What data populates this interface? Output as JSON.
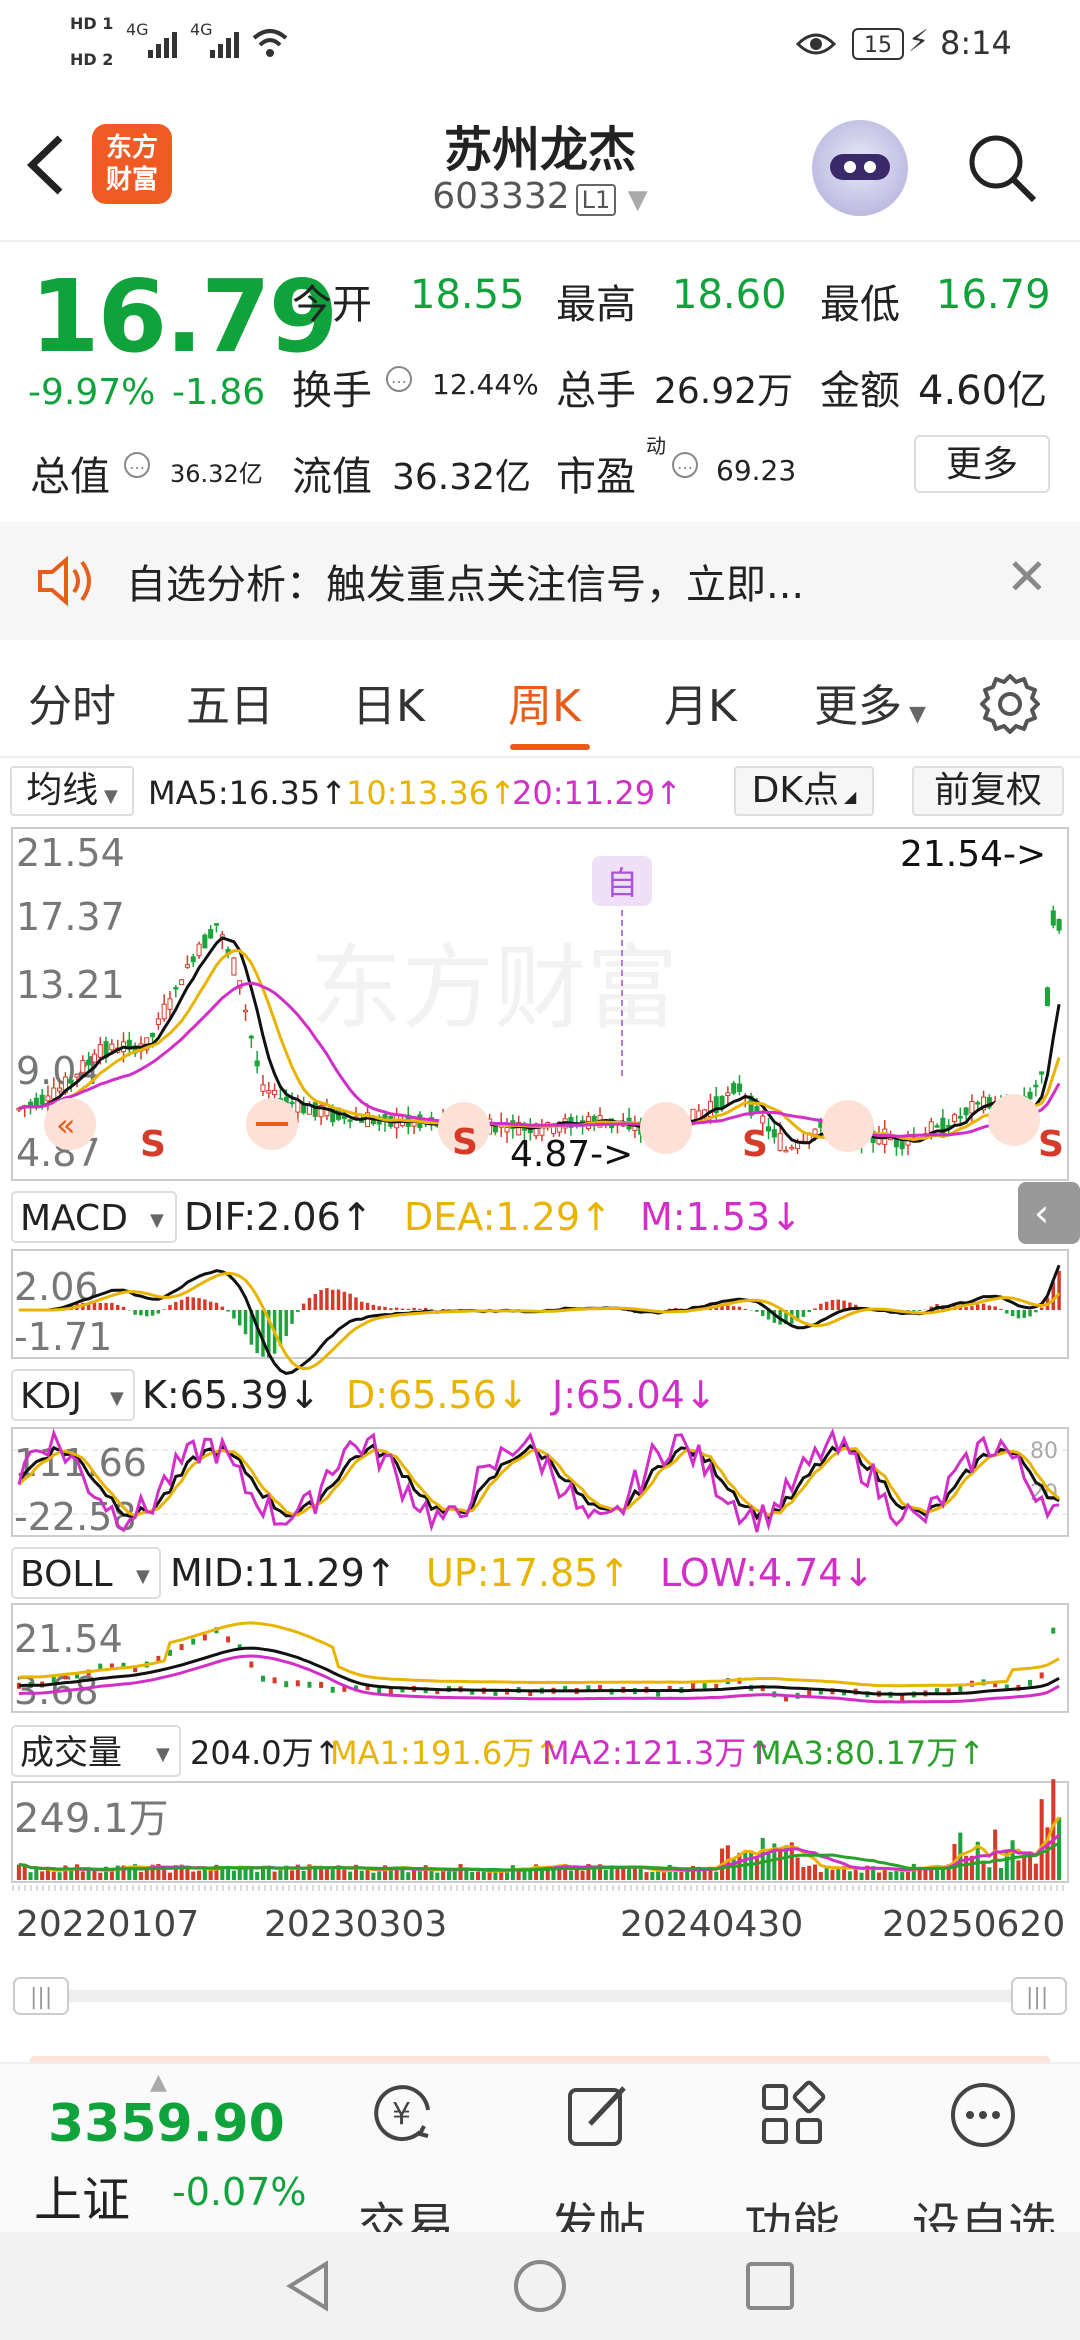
{
  "status_bar": {
    "time": "8:14",
    "battery": "15",
    "sim1": "HD 1",
    "sim2": "HD 2",
    "signal1": "4G",
    "signal2": "4G"
  },
  "header": {
    "title": "苏州龙杰",
    "code": "603332",
    "level": "L1",
    "logo_line1": "东方",
    "logo_line2": "财富"
  },
  "quote": {
    "price": "16.79",
    "change_pct": "-9.97%",
    "change": "-1.86",
    "open_label": "今开",
    "open": "18.55",
    "high_label": "最高",
    "high": "18.60",
    "low_label": "最低",
    "low": "16.79",
    "turnover_label": "换手",
    "turnover": "12.44%",
    "volume_label": "总手",
    "volume": "26.92万",
    "amount_label": "金额",
    "amount": "4.60亿",
    "mktcap_label": "总值",
    "mktcap": "36.32亿",
    "float_label": "流值",
    "float_cap": "36.32亿",
    "pe_label": "市盈",
    "pe_sup": "动",
    "pe": "69.23",
    "more": "更多"
  },
  "banner": {
    "text": "自选分析：触发重点关注信号，立即..."
  },
  "tabs": [
    "分时",
    "五日",
    "日K",
    "周K",
    "月K",
    "更多"
  ],
  "chart": {
    "ma_select": "均线",
    "ma5": "MA5:16.35↑",
    "ma10": "10:13.36↑",
    "ma20": "20:11.29↑",
    "dk": "DK点",
    "adjust": "前复权",
    "y_labels": [
      "21.54",
      "17.37",
      "13.21",
      "9.04",
      "4.87"
    ],
    "max_marker": "21.54->",
    "min_marker": "4.87->",
    "zi_marker": "自",
    "s_marker": "S",
    "watermark": "东方财富",
    "macd": {
      "name": "MACD",
      "dif": "DIF:2.06↑",
      "dea": "DEA:1.29↑",
      "m": "M:1.53↓",
      "top": "2.06",
      "bottom": "-1.71"
    },
    "kdj": {
      "name": "KDJ",
      "k": "K:65.39↓",
      "d": "D:65.56↓",
      "j": "J:65.04↓",
      "top": "111.66",
      "bottom": "-22.58",
      "right_top": "80",
      "right_bottom": "20"
    },
    "boll": {
      "name": "BOLL",
      "mid": "MID:11.29↑",
      "up": "UP:17.85↑",
      "low": "LOW:4.74↓",
      "top": "21.54",
      "bottom": "3.68"
    },
    "vol": {
      "name": "成交量",
      "v": "204.0万↑",
      "ma1": "MA1:191.6万↑",
      "ma2": "MA2:121.3万↑",
      "ma3": "MA3:80.17万↑",
      "top": "249.1万"
    },
    "dates": [
      "20220107",
      "20230303",
      "20240430",
      "20250620"
    ]
  },
  "bottom": {
    "index_value": "3359.90",
    "index_name": "上证",
    "index_change": "-0.07%",
    "tools": [
      "交易",
      "发帖",
      "功能",
      "设自选"
    ]
  }
}
